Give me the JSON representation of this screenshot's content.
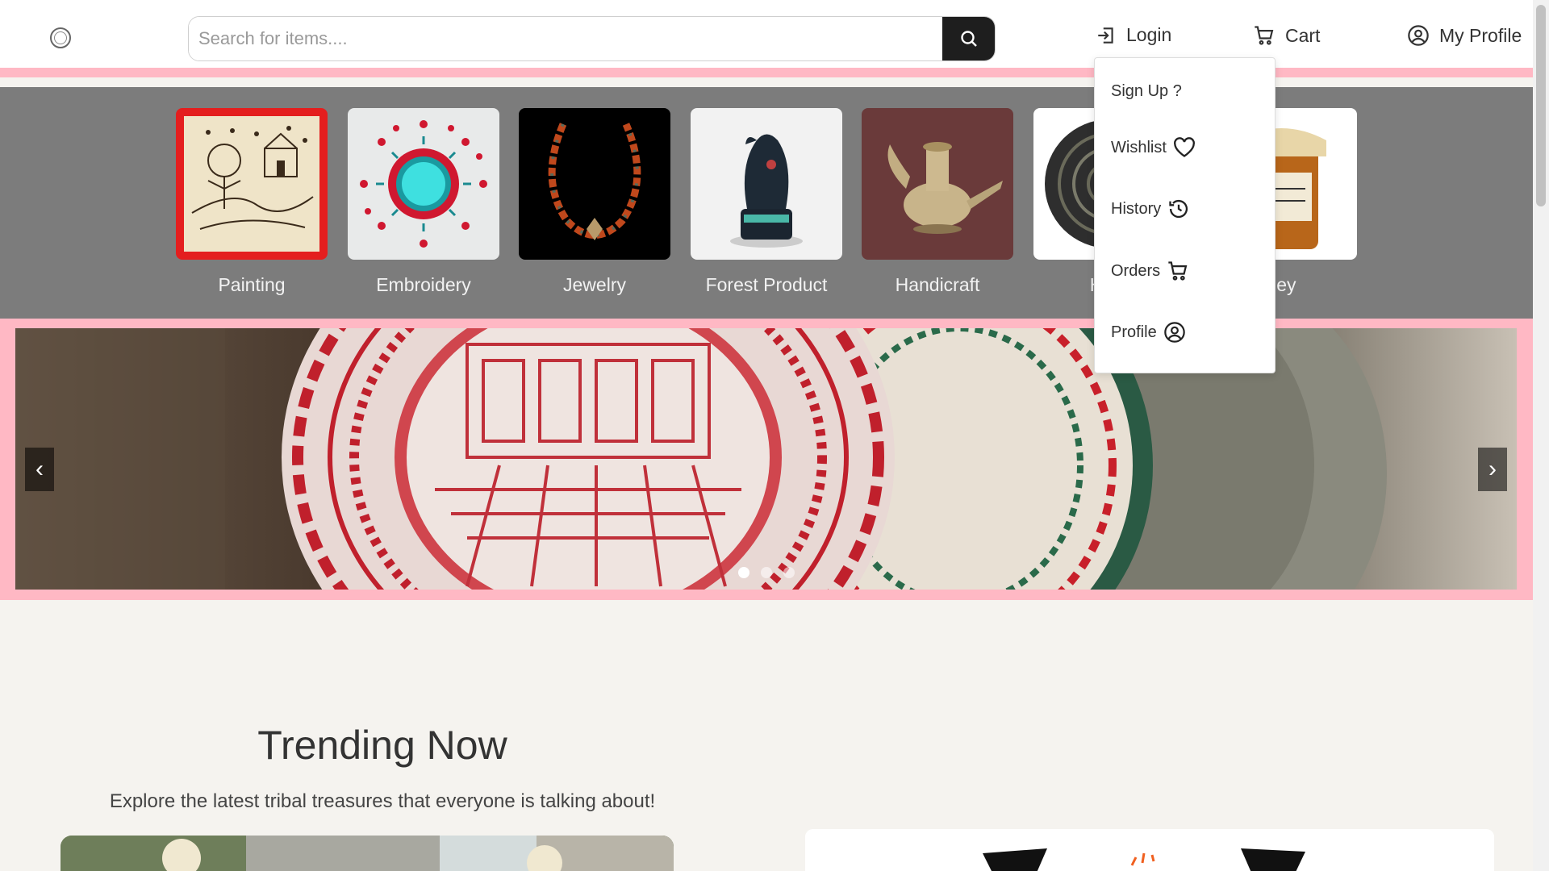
{
  "header": {
    "search_placeholder": "Search for items....",
    "nav": {
      "login": "Login",
      "cart": "Cart",
      "profile": "My Profile"
    }
  },
  "categories": [
    {
      "label": "Painting"
    },
    {
      "label": "Embroidery"
    },
    {
      "label": "Jewelry"
    },
    {
      "label": "Forest Product"
    },
    {
      "label": "Handicraft"
    },
    {
      "label": "Hom"
    },
    {
      "label": "ney"
    }
  ],
  "banner": {
    "prev_glyph": "‹",
    "next_glyph": "›",
    "dots": 3,
    "active_dot": 0
  },
  "dropdown": {
    "signup": "Sign Up ?",
    "wishlist": "Wishlist",
    "history": "History",
    "orders": "Orders",
    "profile": "Profile"
  },
  "trending": {
    "title": "Trending Now",
    "subtitle": "Explore the latest tribal treasures that everyone is talking about!"
  },
  "colors": {
    "accent_pink": "#ffb8c4",
    "category_bg": "#7c7c7c",
    "search_button": "#1e1e1e",
    "page_bg": "#f5f3ef"
  }
}
